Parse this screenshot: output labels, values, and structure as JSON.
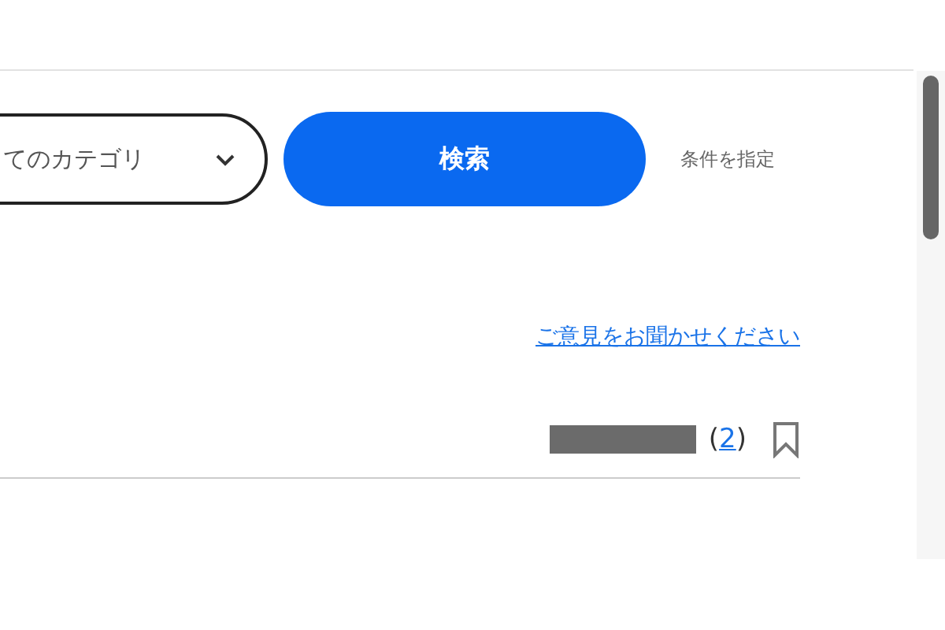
{
  "search": {
    "category_dropdown": {
      "value": "てのカテゴリ"
    },
    "search_button": "検索",
    "advanced_link": "条件を指定"
  },
  "feedback_link": "ご意見をお聞かせください",
  "result_row": {
    "count": {
      "open": "(",
      "number": "2",
      "close": ")"
    },
    "bookmarked": false
  }
}
